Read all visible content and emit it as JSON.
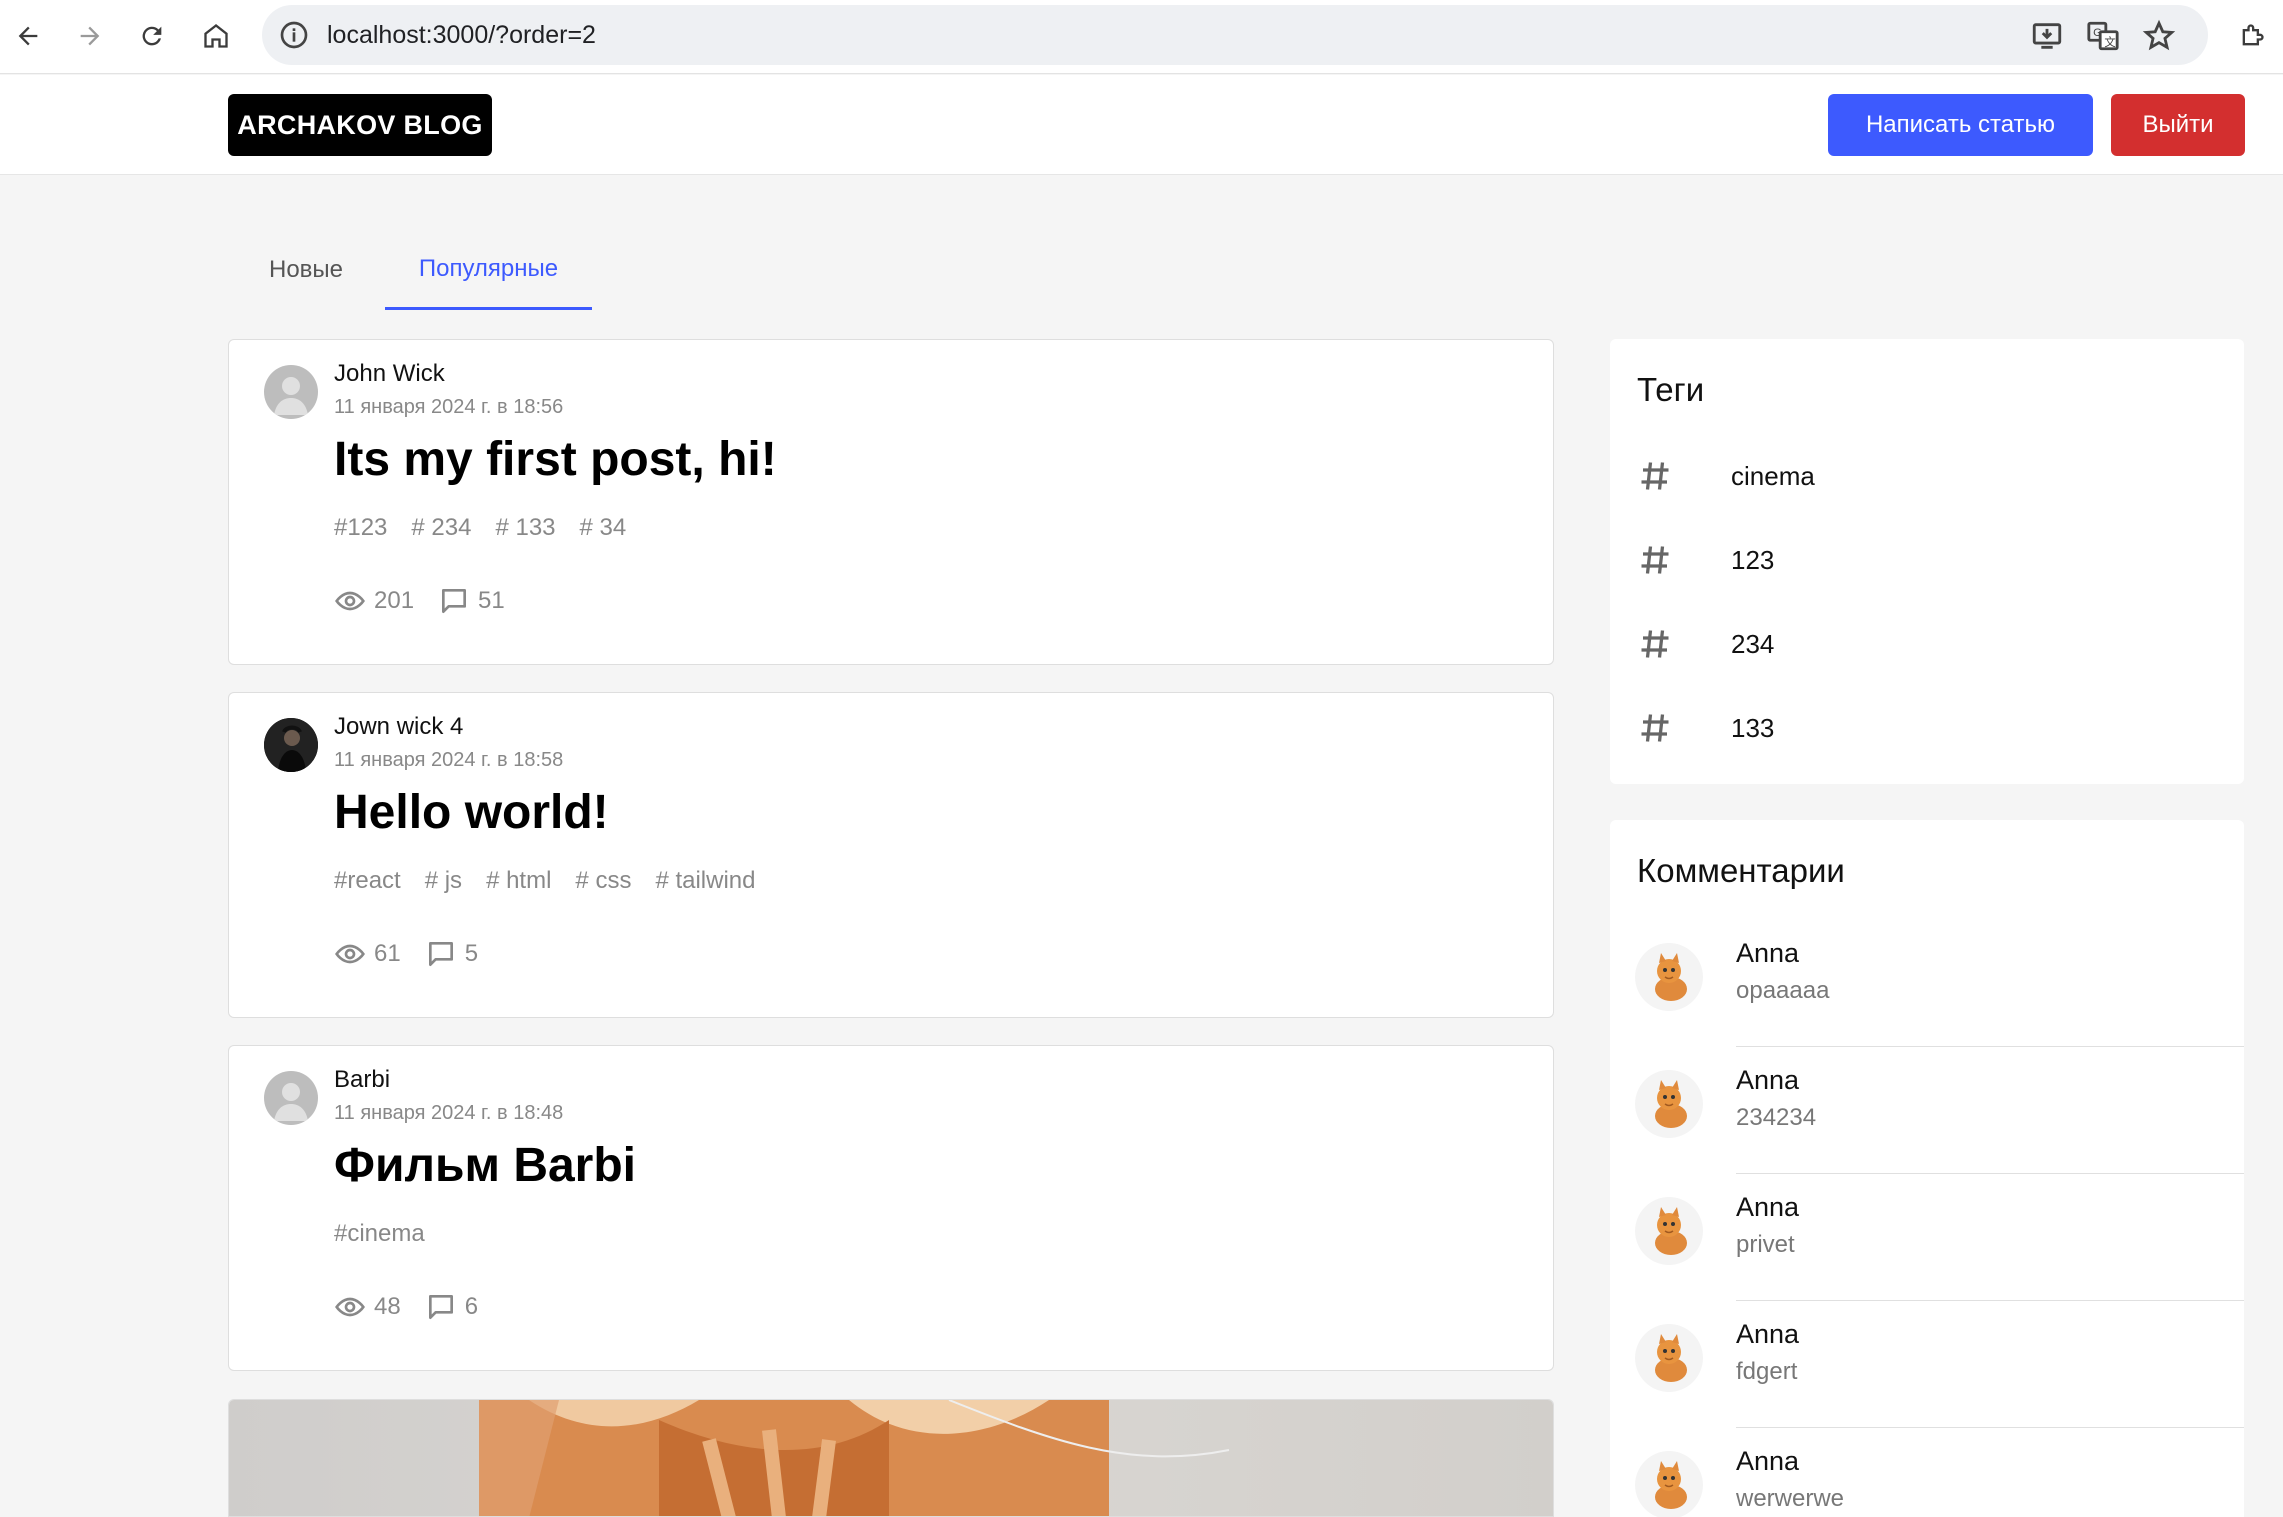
{
  "browser": {
    "url": "localhost:3000/?order=2"
  },
  "header": {
    "logo": "ARCHAKOV BLOG",
    "write_label": "Написать статью",
    "logout_label": "Выйти"
  },
  "tabs": [
    {
      "label": "Новые",
      "active": false
    },
    {
      "label": "Популярные",
      "active": true
    }
  ],
  "posts": [
    {
      "author": "John Wick",
      "date": "11 января 2024 г. в 18:56",
      "title": "Its my first post, hi!",
      "tags": [
        "#123",
        "# 234",
        "# 133",
        "# 34"
      ],
      "views": "201",
      "comments": "51",
      "avatar": "default-avatar"
    },
    {
      "author": "Jown wick 4",
      "date": "11 января 2024 г. в 18:58",
      "title": "Hello world!",
      "tags": [
        "#react",
        "# js",
        "# html",
        "# css",
        "# tailwind"
      ],
      "views": "61",
      "comments": "5",
      "avatar": "photo-avatar"
    },
    {
      "author": "Barbi",
      "date": "11 января 2024 г. в 18:48",
      "title": "Фильм Barbi",
      "tags": [
        "#cinema"
      ],
      "views": "48",
      "comments": "6",
      "avatar": "default-avatar"
    }
  ],
  "sidebar": {
    "tags_title": "Теги",
    "tags": [
      "cinema",
      "123",
      "234",
      "133"
    ],
    "comments_title": "Комментарии",
    "comments": [
      {
        "name": "Anna",
        "text": "opaaaaa"
      },
      {
        "name": "Anna",
        "text": "234234"
      },
      {
        "name": "Anna",
        "text": "privet"
      },
      {
        "name": "Anna",
        "text": "fdgert"
      },
      {
        "name": "Anna",
        "text": "werwerwe"
      }
    ]
  },
  "colors": {
    "accent": "#3d5afe",
    "danger": "#d32f2f",
    "background": "#f5f5f5"
  }
}
